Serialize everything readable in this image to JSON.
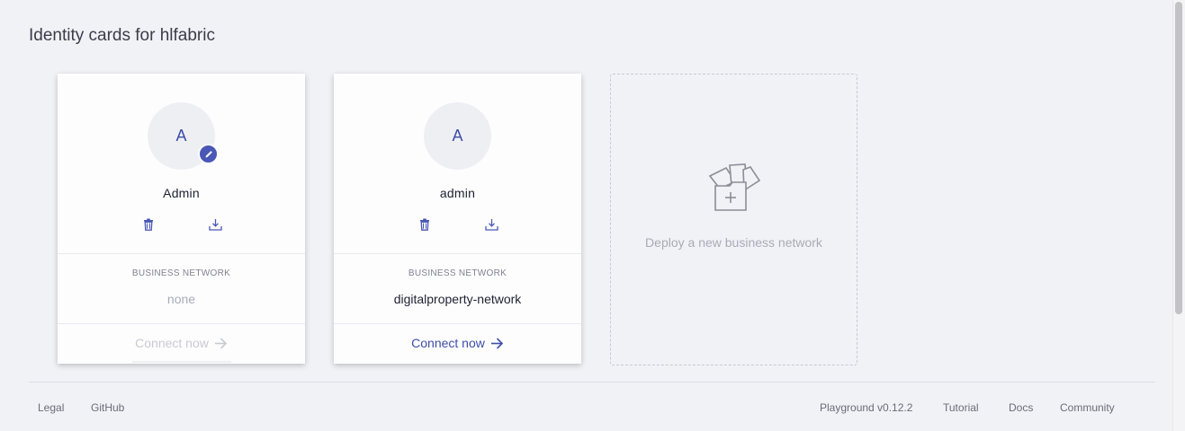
{
  "page": {
    "title": "Identity cards for hlfabric"
  },
  "cards": [
    {
      "avatar_initial": "A",
      "name": "Admin",
      "business_network_label": "BUSINESS NETWORK",
      "business_network": "none",
      "connect_label": "Connect now",
      "connect_enabled": false,
      "edit_badge": "pencil-icon"
    },
    {
      "avatar_initial": "A",
      "name": "admin",
      "business_network_label": "BUSINESS NETWORK",
      "business_network": "digitalproperty-network",
      "connect_label": "Connect now",
      "connect_enabled": true
    }
  ],
  "deploy": {
    "label": "Deploy a new business network",
    "icon": "deploy-network-icon"
  },
  "footer": {
    "legal": "Legal",
    "github": "GitHub",
    "version": "Playground v0.12.2",
    "tutorial": "Tutorial",
    "docs": "Docs",
    "community": "Community"
  },
  "colors": {
    "accent": "#3d4ea8",
    "background": "#f1f2f6",
    "card": "#fdfdfe",
    "muted": "#a9abb6"
  }
}
